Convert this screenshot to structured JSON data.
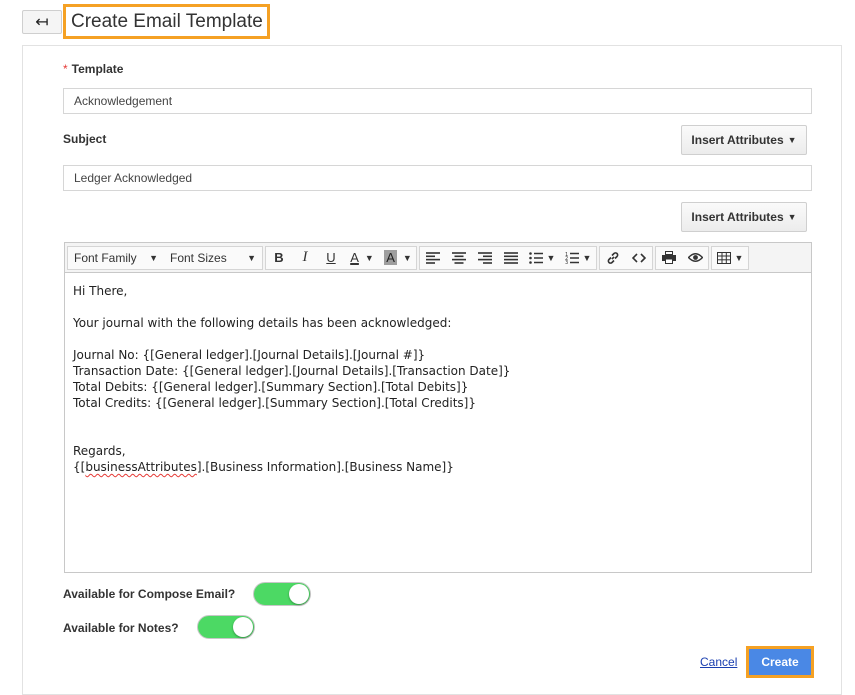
{
  "header": {
    "back_icon": "back-arrow-icon",
    "back_glyph": "↤",
    "title": "Create Email Template"
  },
  "form": {
    "template_label": "Template",
    "required_mark": "*",
    "template_value": "Acknowledgement",
    "subject_label": "Subject",
    "subject_value": "Ledger Acknowledged",
    "insert_attributes_label": "Insert Attributes"
  },
  "toolbar": {
    "font_family": "Font Family",
    "font_sizes": "Font Sizes",
    "bold": "B",
    "italic": "I",
    "underline": "U",
    "text_color": "A",
    "bg_color": "A"
  },
  "body_lines": [
    "Hi There,",
    "",
    "Your journal with the following details has been acknowledged:",
    "",
    "Journal No: {[General ledger].[Journal Details].[Journal #]}",
    "Transaction Date: {[General ledger].[Journal Details].[Transaction Date]}",
    "Total Debits: {[General ledger].[Summary Section].[Total Debits]}",
    "Total Credits: {[General ledger].[Summary Section].[Total Credits]}",
    "",
    "",
    "Regards,"
  ],
  "signature": {
    "prefix": "{[",
    "spell_word": "businessAttributes",
    "suffix": "].[Business Information].[Business Name]}"
  },
  "options": {
    "compose_label": "Available for Compose Email?",
    "compose_enabled": true,
    "notes_label": "Available for Notes?",
    "notes_enabled": true
  },
  "actions": {
    "cancel": "Cancel",
    "create": "Create"
  },
  "colors": {
    "highlight": "#f5a124",
    "primary": "#4a88e5",
    "toggle_on": "#4cd964",
    "required": "#e53935",
    "link": "#1a3fb0"
  }
}
